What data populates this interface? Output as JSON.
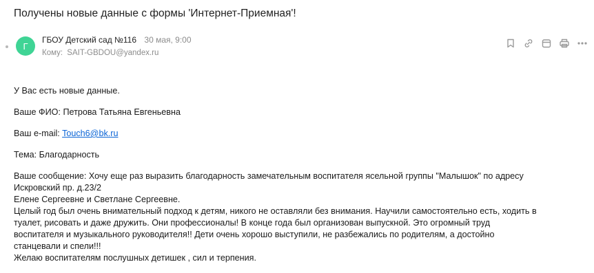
{
  "email": {
    "subject": "Получены новые данные с формы 'Интернет-Приемная'!",
    "sender": {
      "avatar_letter": "Г",
      "name": "ГБОУ Детский сад №116",
      "date": "30 мая, 9:00"
    },
    "to": {
      "label": "Кому:",
      "address": "SAIT-GBDOU@yandex.ru"
    },
    "actions": [
      {
        "name": "bookmark-icon"
      },
      {
        "name": "link-icon"
      },
      {
        "name": "calendar-icon"
      },
      {
        "name": "print-icon"
      },
      {
        "name": "more-icon"
      }
    ],
    "body": {
      "intro": "У Вас есть новые данные.",
      "fio_label": "Ваше ФИО: ",
      "fio_value": "Петрова Татьяна Евгеньевна",
      "email_label": "Ваш e-mail: ",
      "email_value": "Touch6@bk.ru",
      "topic_label": "Тема: ",
      "topic_value": "Благодарность",
      "message_lines": [
        "Ваше сообщение: Хочу еще раз выразить благодарность замечательным воспитателя ясельной группы \"Малышок\" по адресу",
        "Искровский пр. д.23/2",
        "Елене Сергеевне и Светлане Сергеевне.",
        "Целый год был очень внимательный подход к детям, никого не оставляли без внимания. Научили самостоятельно есть, ходить в",
        "туалет, рисовать и даже дружить. Они профессионалы! В конце года был организован выпускной. Это огромный труд",
        "воспитателя и музыкального руководителя!! Дети очень хорошо выступили, не разбежались по родителям, а достойно",
        "станцевали и спели!!!",
        "Желаю воспитателям послушных детишек , сил и терпения."
      ]
    }
  },
  "colors": {
    "avatar": "#3fd495",
    "link": "#0a64d6",
    "muted": "#8c8c8c"
  }
}
